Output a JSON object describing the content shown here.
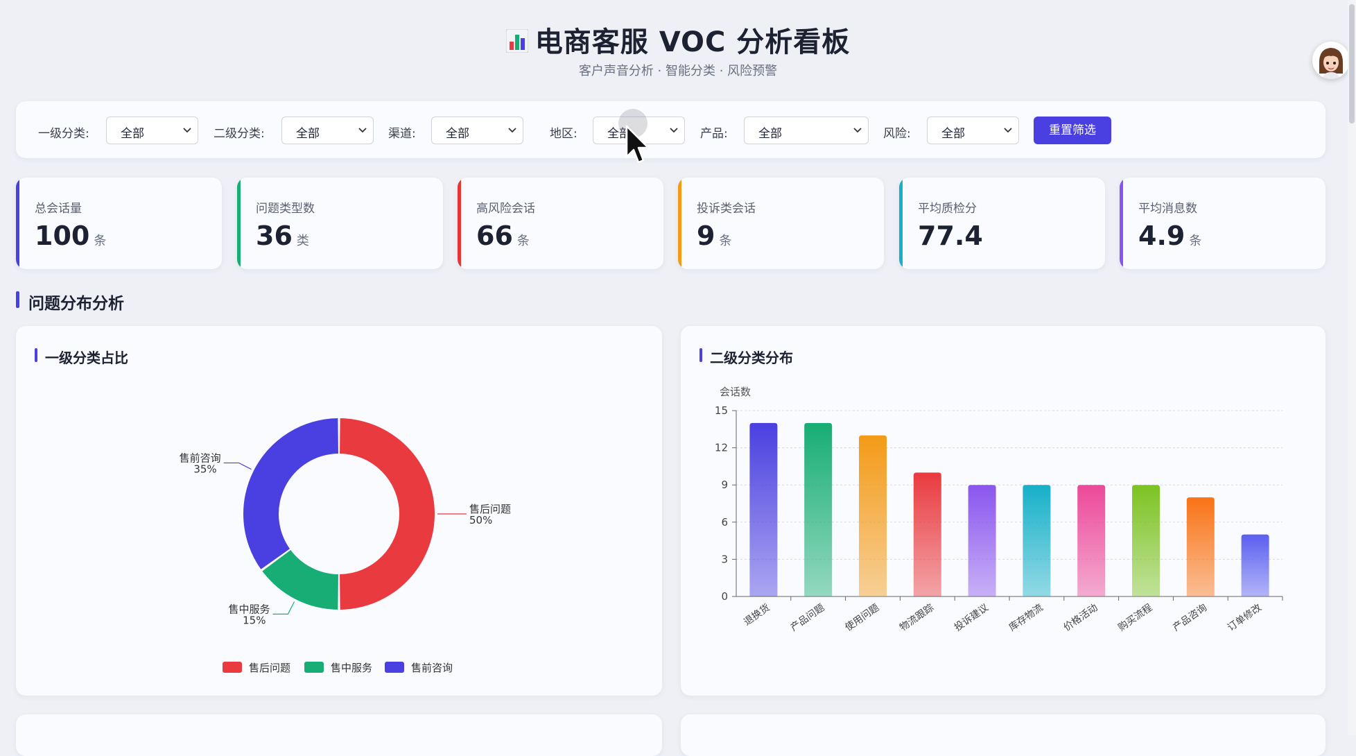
{
  "header": {
    "title": "电商客服 VOC 分析看板",
    "title_icon": "bar-chart-icon",
    "subtitle": "客户声音分析 · 智能分类 · 风险预警"
  },
  "filters": [
    {
      "label": "一级分类:",
      "value": "全部"
    },
    {
      "label": "二级分类:",
      "value": "全部"
    },
    {
      "label": "渠道:",
      "value": "全部"
    },
    {
      "label": "地区:",
      "value": "全部"
    },
    {
      "label": "产品:",
      "value": "全部"
    },
    {
      "label": "风险:",
      "value": "全部"
    }
  ],
  "reset_label": "重置筛选",
  "kpis": [
    {
      "label": "总会话量",
      "value": "100",
      "unit": "条",
      "color": "#4a3fe0"
    },
    {
      "label": "问题类型数",
      "value": "36",
      "unit": "类",
      "color": "#17ad74"
    },
    {
      "label": "高风险会话",
      "value": "66",
      "unit": "条",
      "color": "#e53535"
    },
    {
      "label": "投诉类会话",
      "value": "9",
      "unit": "条",
      "color": "#f39a17"
    },
    {
      "label": "平均质检分",
      "value": "77.4",
      "unit": "",
      "color": "#16b0c8"
    },
    {
      "label": "平均消息数",
      "value": "4.9",
      "unit": "条",
      "color": "#8a55ee"
    }
  ],
  "section": {
    "title": "问题分布分析"
  },
  "pie_panel": {
    "title": "一级分类占比"
  },
  "bar_panel": {
    "title": "二级分类分布"
  },
  "chart_data": [
    {
      "type": "pie",
      "title": "一级分类占比",
      "donut": true,
      "legend": "bottom",
      "categories": [
        "售后问题",
        "售中服务",
        "售前咨询"
      ],
      "values": [
        50,
        15,
        35
      ],
      "labels": [
        "50%",
        "15%",
        "35%"
      ],
      "colors": [
        "#e93a3f",
        "#17ad74",
        "#4a3fe0"
      ]
    },
    {
      "type": "bar",
      "title": "二级分类分布",
      "ylabel": "会话数",
      "ylim": [
        0,
        15
      ],
      "yticks": [
        0,
        3,
        6,
        9,
        12,
        15
      ],
      "grid": true,
      "categories": [
        "退换货",
        "产品问题",
        "使用问题",
        "物流跟踪",
        "投诉建议",
        "库存物流",
        "价格活动",
        "购买流程",
        "产品咨询",
        "订单修改"
      ],
      "values": [
        14,
        14,
        13,
        10,
        9,
        9,
        9,
        9,
        8,
        5
      ],
      "colors": [
        "#4a3fe0",
        "#17ad74",
        "#f39a17",
        "#e93a3f",
        "#8a55ee",
        "#16b0c8",
        "#ec4899",
        "#7cc321",
        "#f97316",
        "#5b5ff0"
      ]
    }
  ]
}
